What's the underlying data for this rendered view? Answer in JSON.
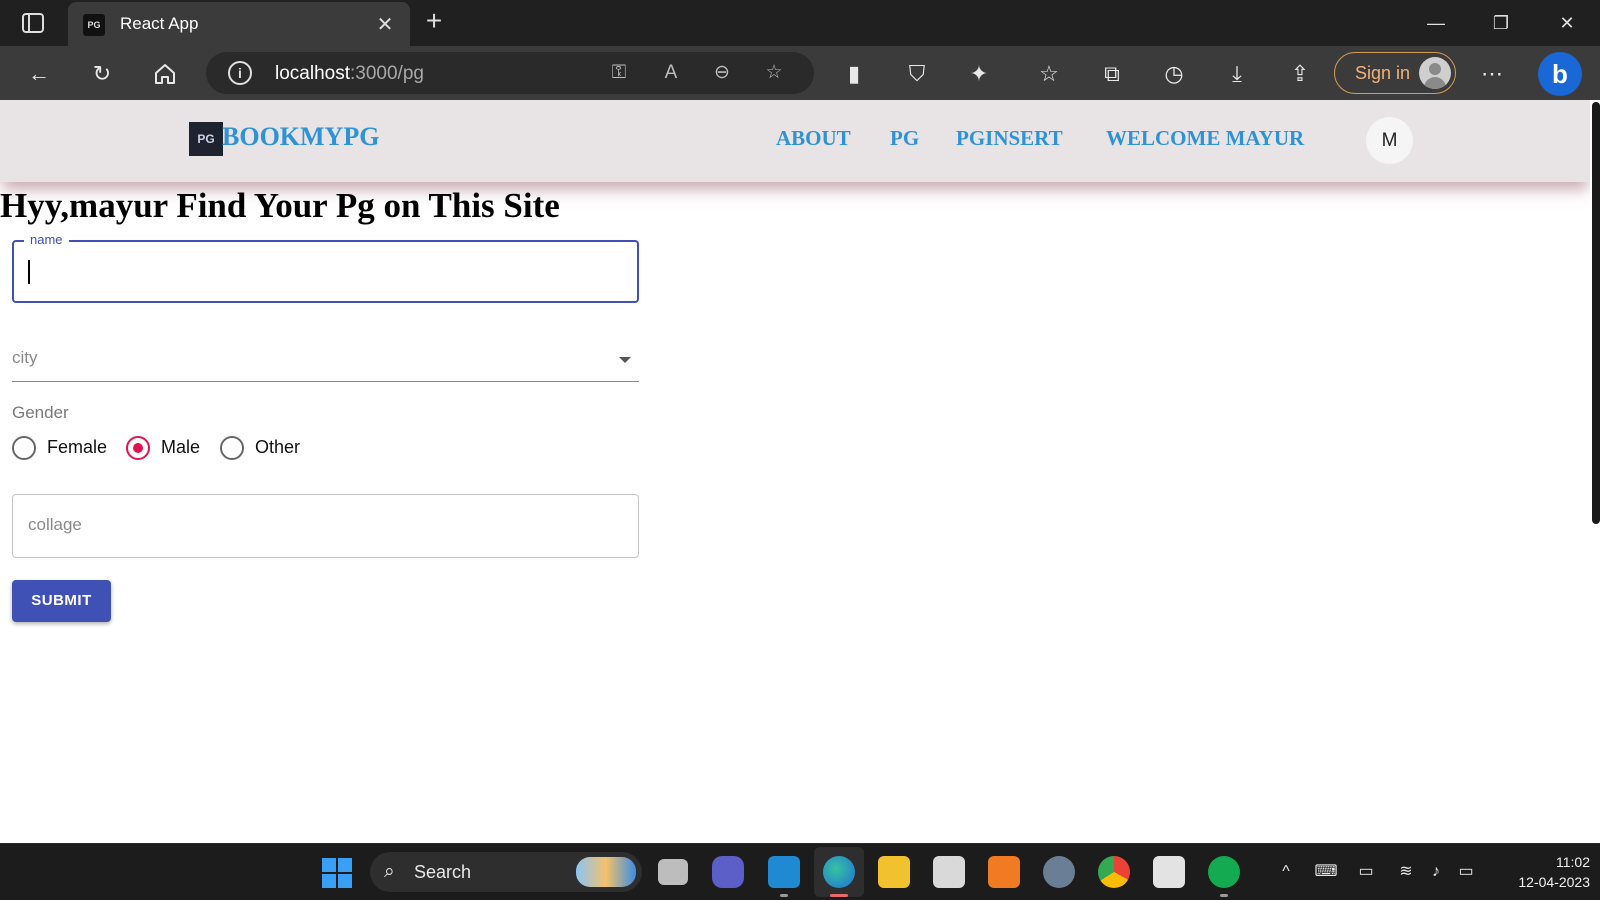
{
  "browser": {
    "tab_title": "React App",
    "url_host": "localhost",
    "url_rest": ":3000/pg",
    "sign_in_label": "Sign in",
    "icons": [
      "sidebar-icon",
      "close-icon",
      "new-tab-icon",
      "back-icon",
      "refresh-icon",
      "home-icon",
      "info-icon",
      "key-icon",
      "read-aloud-icon",
      "zoom-out-icon",
      "favorite-add-icon",
      "extension-icon",
      "shield-icon",
      "puzzle-icon",
      "favorites-icon",
      "collections-icon",
      "history-icon",
      "download-icon",
      "share-icon",
      "more-icon",
      "bing-icon"
    ]
  },
  "navbar": {
    "brand": "BOOKMYPG",
    "logo_text": "PG",
    "links": [
      "ABOUT",
      "PG",
      "PGINSERT",
      "WELCOME MAYUR"
    ],
    "avatar_letter": "M"
  },
  "page": {
    "heading": "Hyy,mayur Find Your Pg on This Site"
  },
  "form": {
    "name_label": "name",
    "name_value": "",
    "city_label": "city",
    "gender_label": "Gender",
    "gender_options": [
      "Female",
      "Male",
      "Other"
    ],
    "gender_selected": "Male",
    "collage_placeholder": "collage",
    "submit_label": "SUBMIT",
    "colors": {
      "primary": "#3f51b5",
      "radio_checked": "#e0134f",
      "link": "#2d93d6"
    }
  },
  "taskbar": {
    "search_label": "Search",
    "time": "11:02",
    "date": "12-04-2023",
    "apps": [
      "task-view-icon",
      "teams-icon",
      "vscode-icon",
      "edge-icon",
      "file-explorer-icon",
      "snipping-tool-icon",
      "xampp-icon",
      "settings-icon",
      "chrome-icon",
      "store-icon",
      "mongodb-icon"
    ]
  }
}
